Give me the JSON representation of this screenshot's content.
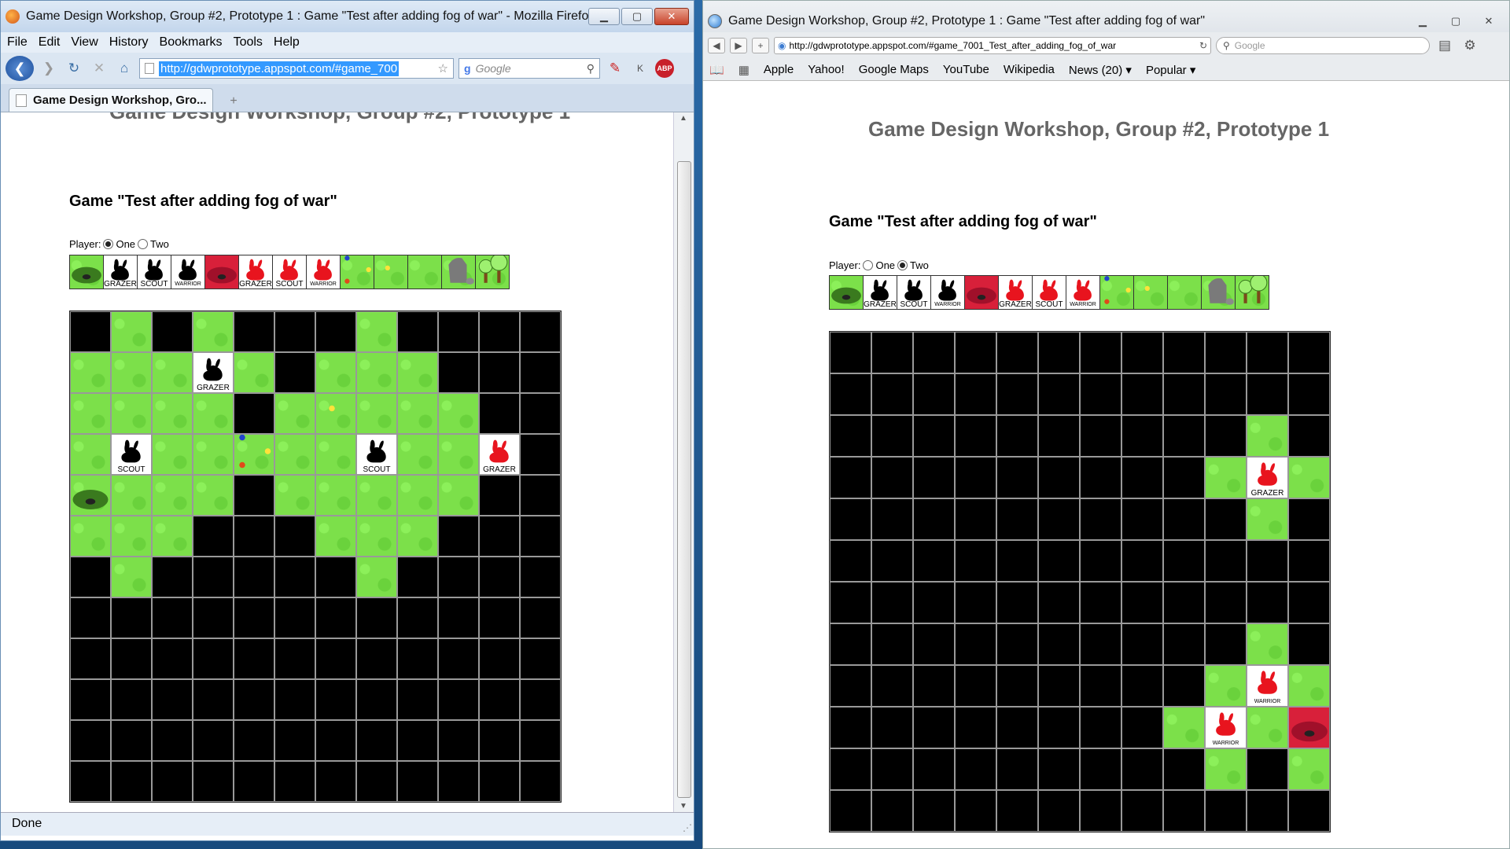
{
  "left_window": {
    "title": "Game Design Workshop, Group #2, Prototype 1 : Game \"Test after adding fog of war\" - Mozilla Firefox",
    "menu": [
      "File",
      "Edit",
      "View",
      "History",
      "Bookmarks",
      "Tools",
      "Help"
    ],
    "url": "http://gdwprototype.appspot.com/#game_700",
    "search_placeholder": "Google",
    "abp_label": "ABP",
    "tab_label": "Game Design Workshop, Gro...",
    "new_tab": "+",
    "status": "Done",
    "page_heading": "Game Design Workshop, Group #2, Prototype 1",
    "game_title": "Game \"Test after adding fog of war\"",
    "player_label": "Player:",
    "player_options": [
      "One",
      "Two"
    ],
    "player_selected": "One"
  },
  "right_window": {
    "title": "Game Design Workshop, Group #2, Prototype 1 : Game \"Test after adding fog of war\"",
    "url": "http://gdwprototype.appspot.com/#game_7001_Test_after_adding_fog_of_war",
    "search_placeholder": "Google",
    "bookmarks": [
      "Apple",
      "Yahoo!",
      "Google Maps",
      "YouTube",
      "Wikipedia",
      "News (20)",
      "Popular"
    ],
    "page_heading": "Game Design Workshop, Group #2, Prototype 1",
    "game_title": "Game \"Test after adding fog of war\"",
    "player_label": "Player:",
    "player_options": [
      "One",
      "Two"
    ],
    "player_selected": "Two"
  },
  "palette": [
    {
      "type": "burrow-green",
      "label": ""
    },
    {
      "type": "rabbit-black",
      "label": "GRAZER"
    },
    {
      "type": "rabbit-black",
      "label": "SCOUT"
    },
    {
      "type": "rabbit-black",
      "label": "WARRIOR"
    },
    {
      "type": "burrow-red",
      "label": ""
    },
    {
      "type": "rabbit-red",
      "label": "GRAZER"
    },
    {
      "type": "rabbit-red",
      "label": "SCOUT"
    },
    {
      "type": "rabbit-red",
      "label": "WARRIOR"
    },
    {
      "type": "flowers",
      "label": ""
    },
    {
      "type": "grass-flower",
      "label": ""
    },
    {
      "type": "grass",
      "label": ""
    },
    {
      "type": "rock",
      "label": ""
    },
    {
      "type": "trees",
      "label": ""
    }
  ],
  "left_board": {
    "rows": [
      "X G X G X X X G X X X X",
      "G G G B G X G G G X X X",
      "G G G G X G F G G G X X",
      "G S G G W G G S G G R X",
      "H G G G X G G G G G X X",
      "G G G X X X G G G X X X",
      "X G X X X X X G X X X X",
      "X X X X X X X X X X X X",
      "X X X X X X X X X X X X",
      "X X X X X X X X X X X X",
      "X X X X X X X X X X X X",
      "X X X X X X X X X X X X"
    ],
    "units": {
      "B": {
        "color": "black",
        "label": "GRAZER"
      },
      "S": {
        "color": "black",
        "label": "SCOUT"
      },
      "R": {
        "color": "red",
        "label": "GRAZER"
      }
    }
  },
  "right_board": {
    "rows": [
      "X X X X X X X X X X X X",
      "X X X X X X X X X X X X",
      "X X X X X X X X X X G X",
      "X X X X X X X X X G R G",
      "X X X X X X X X X X G X",
      "X X X X X X X X X X X X",
      "X X X X X X X X X X X X",
      "X X X X X X X X X X G X",
      "X X X X X X X X X G Q G",
      "X X X X X X X X G Q G D",
      "X X X X X X X X X G X G",
      "X X X X X X X X X X X X"
    ],
    "units": {
      "R": {
        "color": "red",
        "label": "GRAZER"
      },
      "Q": {
        "color": "red",
        "label": "WARRIOR"
      }
    }
  },
  "colors": {
    "grass": "#7ce04a",
    "fog": "#000000",
    "enemy_red": "#e8141e",
    "burrow_red": "#d8203a"
  }
}
